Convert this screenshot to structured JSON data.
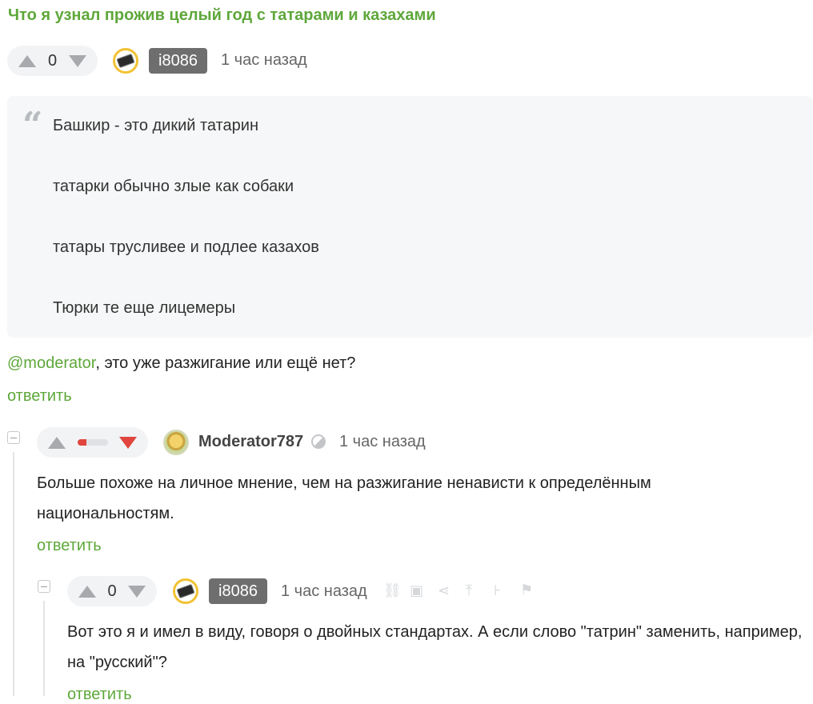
{
  "post": {
    "title": "Что я узнал прожив целый год с татарами и казахами",
    "rating": "0",
    "author": "i8086",
    "time": "1 час назад",
    "quote_lines": [
      "Башкир - это дикий татарин",
      "татарки обычно злые как собаки",
      "татары трусливее и подлее казахов",
      "Тюрки те еще лицемеры"
    ],
    "mention": "@moderator",
    "text_after_mention": ", это уже разжигание или ещё нет?",
    "reply_label": "ответить"
  },
  "comment1": {
    "author": "Moderator787",
    "time": "1 час назад",
    "rating_fill": 0.3,
    "text": "Больше похоже на личное мнение, чем на разжигание ненависти к определённым национальностям.",
    "reply_label": "ответить",
    "icons": [
      "moderator-badge-icon"
    ]
  },
  "comment2": {
    "rating": "0",
    "author": "i8086",
    "time": "1 час назад",
    "text": "Вот это я и имел в виду, говоря о двойных стандартах. А если слово \"татрин\" заменить, например, на \"русский\"?",
    "reply_label": "ответить",
    "icons": [
      "link-icon",
      "save-icon",
      "share-icon",
      "scroll-up-icon",
      "branch-icon",
      "flag-icon"
    ]
  },
  "colors": {
    "accent": "#5ea73a",
    "downvote_active": "#e0463d",
    "badge_bg": "#6e6e6e"
  }
}
